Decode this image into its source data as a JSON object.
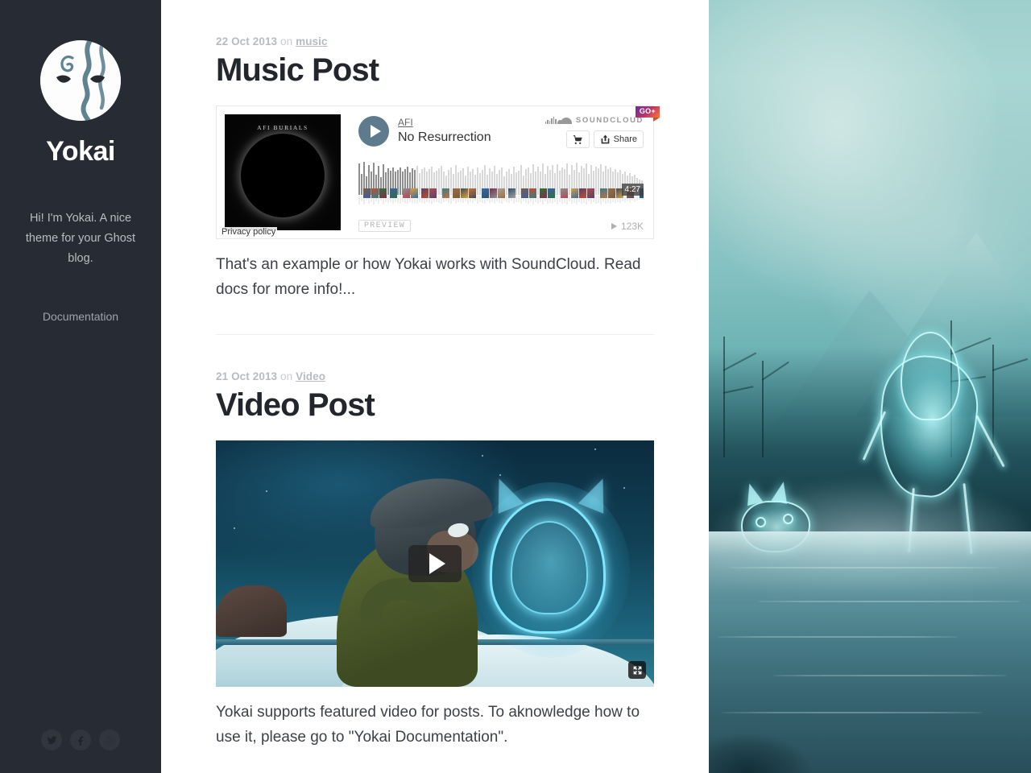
{
  "sidebar": {
    "logo_icon": "yokai-mask-icon",
    "blog_title": "Yokai",
    "description": "Hi! I'm Yokai. A nice theme for your Ghost blog.",
    "nav": [
      {
        "label": "Documentation",
        "name": "documentation"
      }
    ],
    "social": [
      {
        "icon": "twitter-icon",
        "name": "twitter"
      },
      {
        "icon": "facebook-icon",
        "name": "facebook"
      },
      {
        "icon": "dribbble-icon",
        "name": "dribbble"
      }
    ],
    "colors": {
      "background": "#272b33",
      "title": "#ffffff",
      "text": "#b9bcc2"
    }
  },
  "posts": [
    {
      "date": "22 Oct 2013",
      "on": "on",
      "tag": "music",
      "title": "Music Post",
      "excerpt": "That's an example or how Yokai works with SoundCloud. Read docs for more info!...",
      "embed": "soundcloud"
    },
    {
      "date": "21 Oct 2013",
      "on": "on",
      "tag": "Video",
      "title": "Video Post",
      "excerpt": "Yokai supports featured video for posts. To aknowledge how to use it, please go to \"Yokai Documentation\".",
      "embed": "video"
    }
  ],
  "soundcloud": {
    "brand": "SOUNDCLOUD",
    "badge": "GO+",
    "artwork_label": "AFI BURIALS",
    "artist": "AFI",
    "track": "No Resurrection",
    "share_label": "Share",
    "cart_icon": "cart-icon",
    "share_icon": "share-icon",
    "play_icon": "play-icon",
    "duration": "4:27",
    "preview_label": "PREVIEW",
    "play_count": "123K",
    "privacy_policy": "Privacy policy",
    "progress_percent": 20
  },
  "video": {
    "play_icon": "play-icon",
    "fullscreen_icon": "fullscreen-icon"
  },
  "hero": {
    "alt_name": "yokai-ghost-landscape"
  },
  "colors": {
    "accent": "#5d7b8c",
    "heading": "#23272d",
    "meta": "#b7bbc2",
    "body_text": "#3c4148",
    "divider": "#eceef0"
  }
}
